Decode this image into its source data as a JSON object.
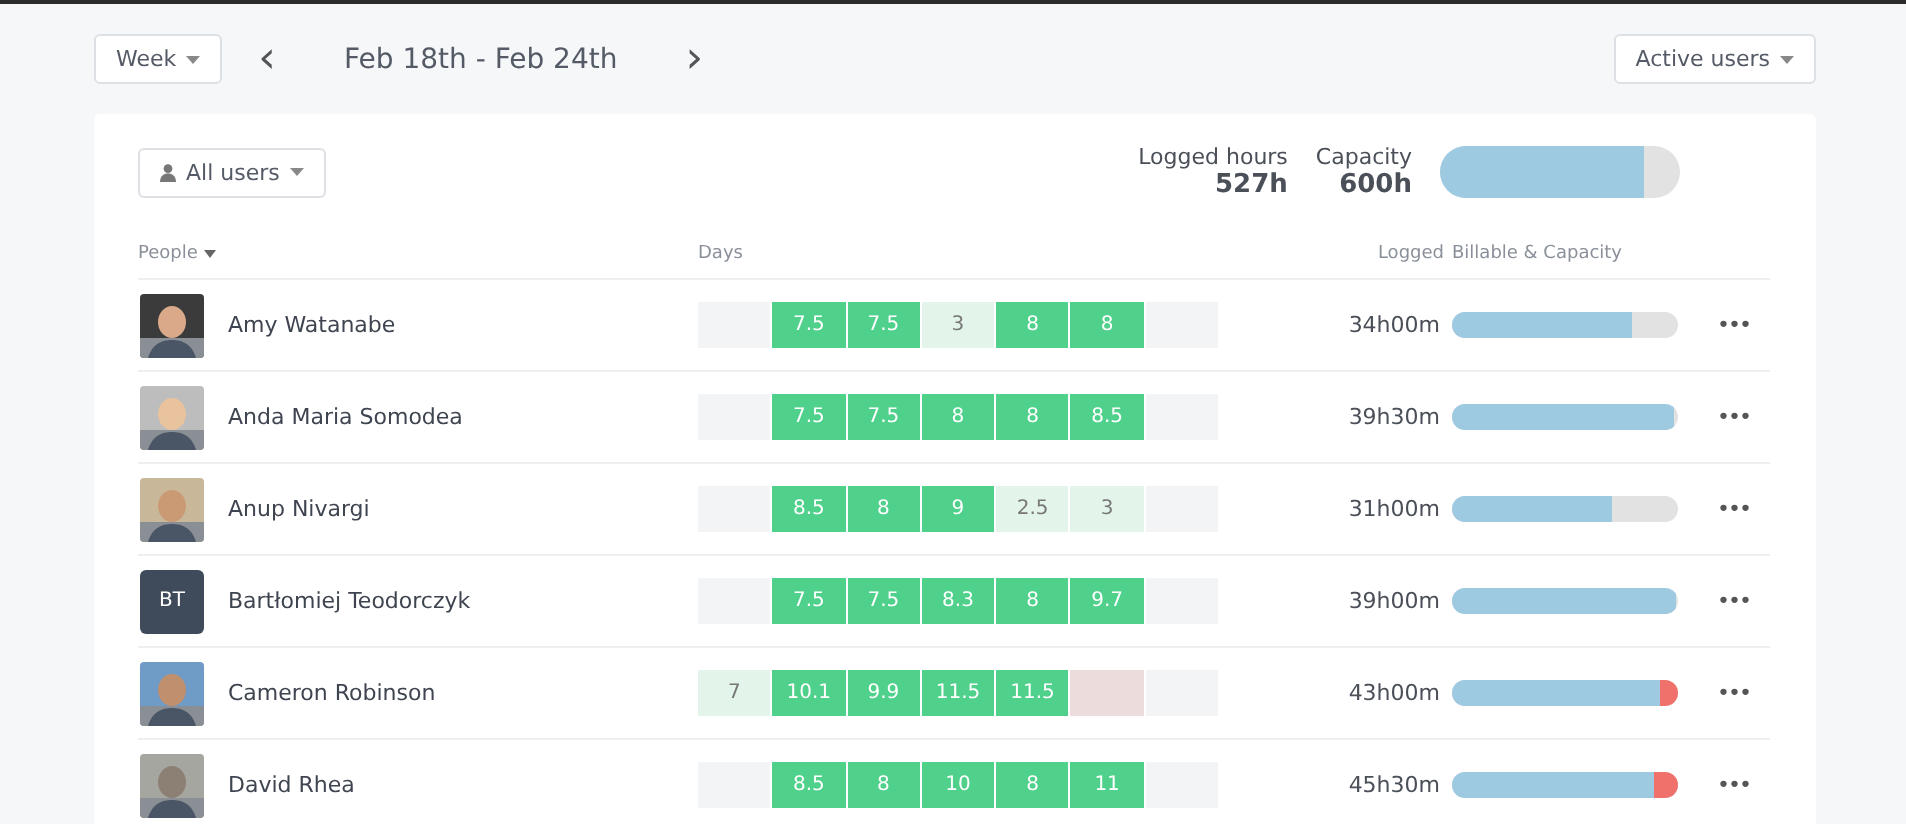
{
  "toolbar": {
    "period_button": "Week",
    "prev_icon": "‹",
    "date_range": "Feb 18th - Feb 24th",
    "next_icon": "›",
    "filter_button": "Active users"
  },
  "summary": {
    "users_button": "All users",
    "logged_label": "Logged hours",
    "logged_value": "527h",
    "capacity_label": "Capacity",
    "capacity_value": "600h",
    "level": 0.85
  },
  "table": {
    "columns": [
      "People",
      "Days",
      "Logged",
      "Billable & Capacity"
    ],
    "rows": [
      {
        "name": "Amy Watanabe",
        "days": [
          {
            "kind": "empty"
          },
          {
            "kind": "full",
            "value": "7.5"
          },
          {
            "kind": "full",
            "value": "7.5"
          },
          {
            "kind": "low",
            "value": "3"
          },
          {
            "kind": "full",
            "value": "8"
          },
          {
            "kind": "full",
            "value": "8"
          },
          {
            "kind": "empty"
          }
        ],
        "logged": "34h00m",
        "capacity": {
          "kind": "under",
          "level": 0.8
        },
        "menu": "•••"
      },
      {
        "name": "Anda Maria Somodea",
        "days": [
          {
            "kind": "empty"
          },
          {
            "kind": "full",
            "value": "7.5"
          },
          {
            "kind": "full",
            "value": "7.5"
          },
          {
            "kind": "full",
            "value": "8"
          },
          {
            "kind": "full",
            "value": "8"
          },
          {
            "kind": "full",
            "value": "8.5"
          },
          {
            "kind": "empty"
          }
        ],
        "logged": "39h30m",
        "capacity": {
          "kind": "under",
          "level": 0.98
        },
        "menu": "•••"
      },
      {
        "name": "Anup Nivargi",
        "days": [
          {
            "kind": "empty"
          },
          {
            "kind": "full",
            "value": "8.5"
          },
          {
            "kind": "full",
            "value": "8"
          },
          {
            "kind": "full",
            "value": "9"
          },
          {
            "kind": "low",
            "value": "2.5"
          },
          {
            "kind": "low",
            "value": "3"
          },
          {
            "kind": "empty"
          }
        ],
        "logged": "31h00m",
        "capacity": {
          "kind": "under",
          "level": 0.71
        },
        "menu": "•••"
      },
      {
        "avatar": {
          "kind": "initials",
          "initials": "BT"
        },
        "name": "Bartłomiej Teodorczyk",
        "days": [
          {
            "kind": "empty"
          },
          {
            "kind": "full",
            "value": "7.5"
          },
          {
            "kind": "full",
            "value": "7.5"
          },
          {
            "kind": "full",
            "value": "8.3"
          },
          {
            "kind": "full",
            "value": "8"
          },
          {
            "kind": "full",
            "value": "9.7"
          },
          {
            "kind": "empty"
          }
        ],
        "logged": "39h00m",
        "capacity": {
          "kind": "under",
          "level": 0.99
        },
        "menu": "•••"
      },
      {
        "name": "Cameron Robinson",
        "days": [
          {
            "kind": "low",
            "value": "7"
          },
          {
            "kind": "full",
            "value": "10.1"
          },
          {
            "kind": "full",
            "value": "9.9"
          },
          {
            "kind": "full",
            "value": "11.5"
          },
          {
            "kind": "full",
            "value": "11.5"
          },
          {
            "kind": "missing"
          },
          {
            "kind": "empty"
          }
        ],
        "logged": "43h00m",
        "capacity": {
          "kind": "over",
          "level": 0.92
        },
        "menu": "•••"
      },
      {
        "name": "David Rhea",
        "days": [
          {
            "kind": "empty"
          },
          {
            "kind": "full",
            "value": "8.5"
          },
          {
            "kind": "full",
            "value": "8"
          },
          {
            "kind": "full",
            "value": "10"
          },
          {
            "kind": "full",
            "value": "8"
          },
          {
            "kind": "full",
            "value": "11"
          },
          {
            "kind": "empty"
          }
        ],
        "logged": "45h30m",
        "capacity": {
          "kind": "over",
          "level": 0.89
        },
        "menu": "•••"
      }
    ]
  }
}
